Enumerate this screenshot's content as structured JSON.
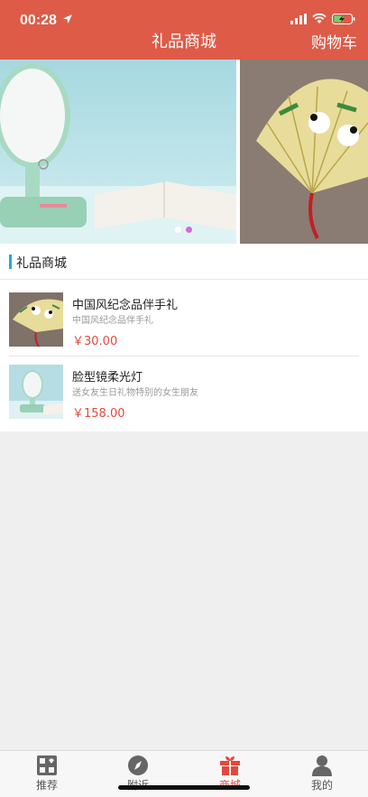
{
  "status_bar": {
    "time": "00:28"
  },
  "header": {
    "title": "礼品商城",
    "cart_label": "购物车"
  },
  "banner": {
    "slide_count": 2,
    "active_index": 1
  },
  "section": {
    "title": "礼品商城",
    "products": [
      {
        "name": "中国风纪念品伴手礼",
        "desc": "中国风纪念品伴手礼",
        "price": "￥30.00"
      },
      {
        "name": "脸型镜柔光灯",
        "desc": "送女友生日礼物特别的女生朋友",
        "price": "￥158.00"
      }
    ]
  },
  "tabbar": {
    "tabs": [
      {
        "label": "推荐",
        "icon": "recommend-icon"
      },
      {
        "label": "附近",
        "icon": "compass-icon"
      },
      {
        "label": "商城",
        "icon": "gift-icon"
      },
      {
        "label": "我的",
        "icon": "user-icon"
      }
    ],
    "active_index": 2
  },
  "colors": {
    "header": "#de5b48",
    "accent": "#1fa7e6",
    "price": "#e04a3c"
  }
}
